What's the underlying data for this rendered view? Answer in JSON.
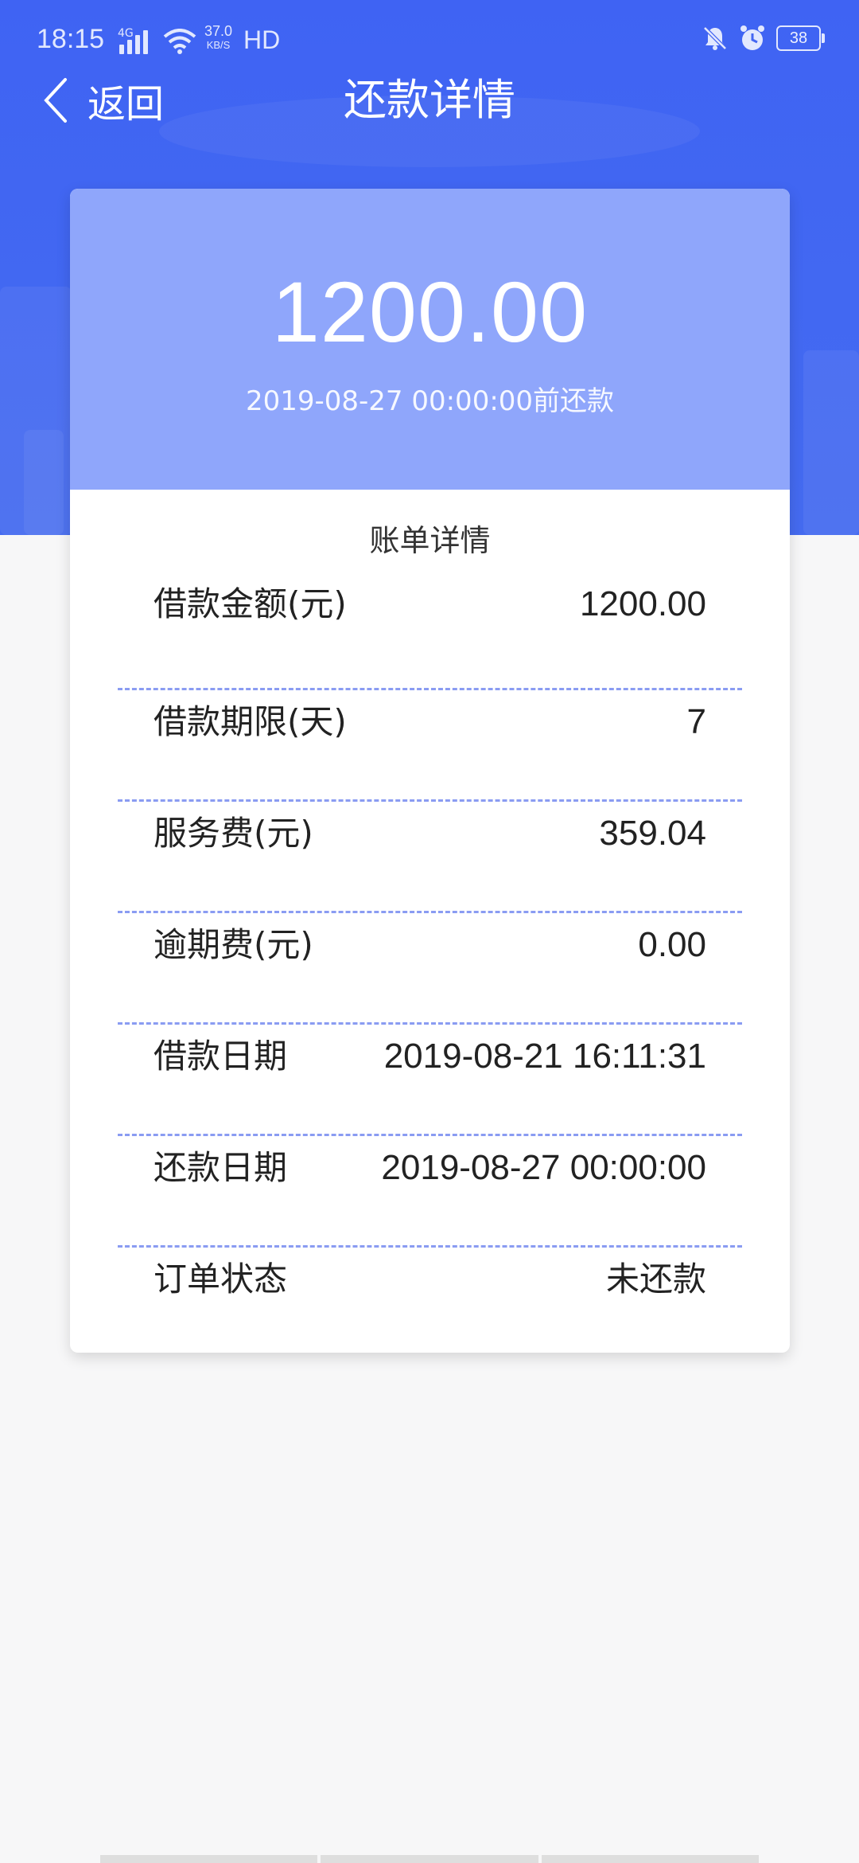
{
  "status_bar": {
    "time": "18:15",
    "network": "4G",
    "speed_value": "37.0",
    "speed_unit": "KB/S",
    "hd": "HD",
    "battery": "38",
    "icons": [
      "signal-icon",
      "wifi-icon",
      "mute-icon",
      "alarm-icon",
      "battery-icon"
    ]
  },
  "nav": {
    "back_label": "返回",
    "title": "还款详情"
  },
  "summary": {
    "amount": "1200.00",
    "due_text": "2019-08-27 00:00:00前还款"
  },
  "bill": {
    "title": "账单详情",
    "rows": [
      {
        "label": "借款金额(元)",
        "value": "1200.00"
      },
      {
        "label": "借款期限(天)",
        "value": "7"
      },
      {
        "label": "服务费(元)",
        "value": "359.04"
      },
      {
        "label": "逾期费(元)",
        "value": "0.00"
      },
      {
        "label": "借款日期",
        "value": "2019-08-21 16:11:31"
      },
      {
        "label": "还款日期",
        "value": "2019-08-27 00:00:00"
      },
      {
        "label": "订单状态",
        "value": "未还款"
      }
    ]
  },
  "colors": {
    "header_blue": "#4268f2",
    "card_top": "#8fa6fb",
    "divider": "#8a9cf2",
    "page_bg": "#f7f7f8"
  }
}
